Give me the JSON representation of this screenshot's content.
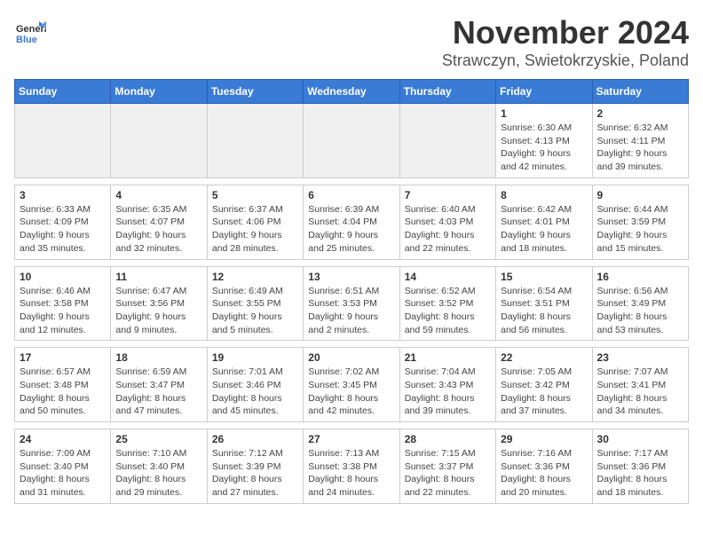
{
  "header": {
    "logo_general": "General",
    "logo_blue": "Blue",
    "month_title": "November 2024",
    "location": "Strawczyn, Swietokrzyskie, Poland"
  },
  "weekdays": [
    "Sunday",
    "Monday",
    "Tuesday",
    "Wednesday",
    "Thursday",
    "Friday",
    "Saturday"
  ],
  "weeks": [
    [
      {
        "day": "",
        "info": ""
      },
      {
        "day": "",
        "info": ""
      },
      {
        "day": "",
        "info": ""
      },
      {
        "day": "",
        "info": ""
      },
      {
        "day": "",
        "info": ""
      },
      {
        "day": "1",
        "info": "Sunrise: 6:30 AM\nSunset: 4:13 PM\nDaylight: 9 hours\nand 42 minutes."
      },
      {
        "day": "2",
        "info": "Sunrise: 6:32 AM\nSunset: 4:11 PM\nDaylight: 9 hours\nand 39 minutes."
      }
    ],
    [
      {
        "day": "3",
        "info": "Sunrise: 6:33 AM\nSunset: 4:09 PM\nDaylight: 9 hours\nand 35 minutes."
      },
      {
        "day": "4",
        "info": "Sunrise: 6:35 AM\nSunset: 4:07 PM\nDaylight: 9 hours\nand 32 minutes."
      },
      {
        "day": "5",
        "info": "Sunrise: 6:37 AM\nSunset: 4:06 PM\nDaylight: 9 hours\nand 28 minutes."
      },
      {
        "day": "6",
        "info": "Sunrise: 6:39 AM\nSunset: 4:04 PM\nDaylight: 9 hours\nand 25 minutes."
      },
      {
        "day": "7",
        "info": "Sunrise: 6:40 AM\nSunset: 4:03 PM\nDaylight: 9 hours\nand 22 minutes."
      },
      {
        "day": "8",
        "info": "Sunrise: 6:42 AM\nSunset: 4:01 PM\nDaylight: 9 hours\nand 18 minutes."
      },
      {
        "day": "9",
        "info": "Sunrise: 6:44 AM\nSunset: 3:59 PM\nDaylight: 9 hours\nand 15 minutes."
      }
    ],
    [
      {
        "day": "10",
        "info": "Sunrise: 6:46 AM\nSunset: 3:58 PM\nDaylight: 9 hours\nand 12 minutes."
      },
      {
        "day": "11",
        "info": "Sunrise: 6:47 AM\nSunset: 3:56 PM\nDaylight: 9 hours\nand 9 minutes."
      },
      {
        "day": "12",
        "info": "Sunrise: 6:49 AM\nSunset: 3:55 PM\nDaylight: 9 hours\nand 5 minutes."
      },
      {
        "day": "13",
        "info": "Sunrise: 6:51 AM\nSunset: 3:53 PM\nDaylight: 9 hours\nand 2 minutes."
      },
      {
        "day": "14",
        "info": "Sunrise: 6:52 AM\nSunset: 3:52 PM\nDaylight: 8 hours\nand 59 minutes."
      },
      {
        "day": "15",
        "info": "Sunrise: 6:54 AM\nSunset: 3:51 PM\nDaylight: 8 hours\nand 56 minutes."
      },
      {
        "day": "16",
        "info": "Sunrise: 6:56 AM\nSunset: 3:49 PM\nDaylight: 8 hours\nand 53 minutes."
      }
    ],
    [
      {
        "day": "17",
        "info": "Sunrise: 6:57 AM\nSunset: 3:48 PM\nDaylight: 8 hours\nand 50 minutes."
      },
      {
        "day": "18",
        "info": "Sunrise: 6:59 AM\nSunset: 3:47 PM\nDaylight: 8 hours\nand 47 minutes."
      },
      {
        "day": "19",
        "info": "Sunrise: 7:01 AM\nSunset: 3:46 PM\nDaylight: 8 hours\nand 45 minutes."
      },
      {
        "day": "20",
        "info": "Sunrise: 7:02 AM\nSunset: 3:45 PM\nDaylight: 8 hours\nand 42 minutes."
      },
      {
        "day": "21",
        "info": "Sunrise: 7:04 AM\nSunset: 3:43 PM\nDaylight: 8 hours\nand 39 minutes."
      },
      {
        "day": "22",
        "info": "Sunrise: 7:05 AM\nSunset: 3:42 PM\nDaylight: 8 hours\nand 37 minutes."
      },
      {
        "day": "23",
        "info": "Sunrise: 7:07 AM\nSunset: 3:41 PM\nDaylight: 8 hours\nand 34 minutes."
      }
    ],
    [
      {
        "day": "24",
        "info": "Sunrise: 7:09 AM\nSunset: 3:40 PM\nDaylight: 8 hours\nand 31 minutes."
      },
      {
        "day": "25",
        "info": "Sunrise: 7:10 AM\nSunset: 3:40 PM\nDaylight: 8 hours\nand 29 minutes."
      },
      {
        "day": "26",
        "info": "Sunrise: 7:12 AM\nSunset: 3:39 PM\nDaylight: 8 hours\nand 27 minutes."
      },
      {
        "day": "27",
        "info": "Sunrise: 7:13 AM\nSunset: 3:38 PM\nDaylight: 8 hours\nand 24 minutes."
      },
      {
        "day": "28",
        "info": "Sunrise: 7:15 AM\nSunset: 3:37 PM\nDaylight: 8 hours\nand 22 minutes."
      },
      {
        "day": "29",
        "info": "Sunrise: 7:16 AM\nSunset: 3:36 PM\nDaylight: 8 hours\nand 20 minutes."
      },
      {
        "day": "30",
        "info": "Sunrise: 7:17 AM\nSunset: 3:36 PM\nDaylight: 8 hours\nand 18 minutes."
      }
    ]
  ]
}
